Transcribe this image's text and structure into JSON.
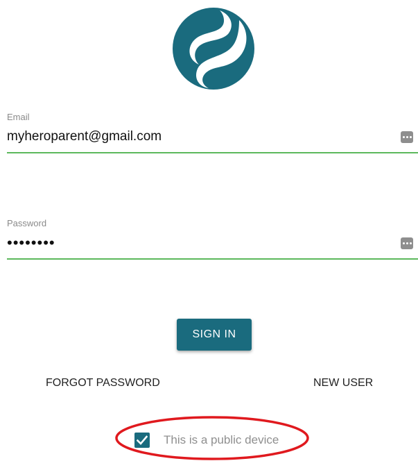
{
  "logo": {
    "icon": "brand-swirl-logo",
    "color": "#1a6b7e"
  },
  "email": {
    "label": "Email",
    "value": "myheroparent@gmail.com",
    "manager_icon": "password-manager-icon"
  },
  "password": {
    "label": "Password",
    "value": "••••••••",
    "manager_icon": "password-manager-icon"
  },
  "actions": {
    "sign_in_label": "SIGN IN",
    "forgot_password_label": "FORGOT PASSWORD",
    "new_user_label": "NEW USER"
  },
  "public_device": {
    "label": "This is a public device",
    "checked": true
  },
  "colors": {
    "brand": "#1a6b7e",
    "field_underline": "#5cb85c",
    "annotation": "#e0191e"
  }
}
